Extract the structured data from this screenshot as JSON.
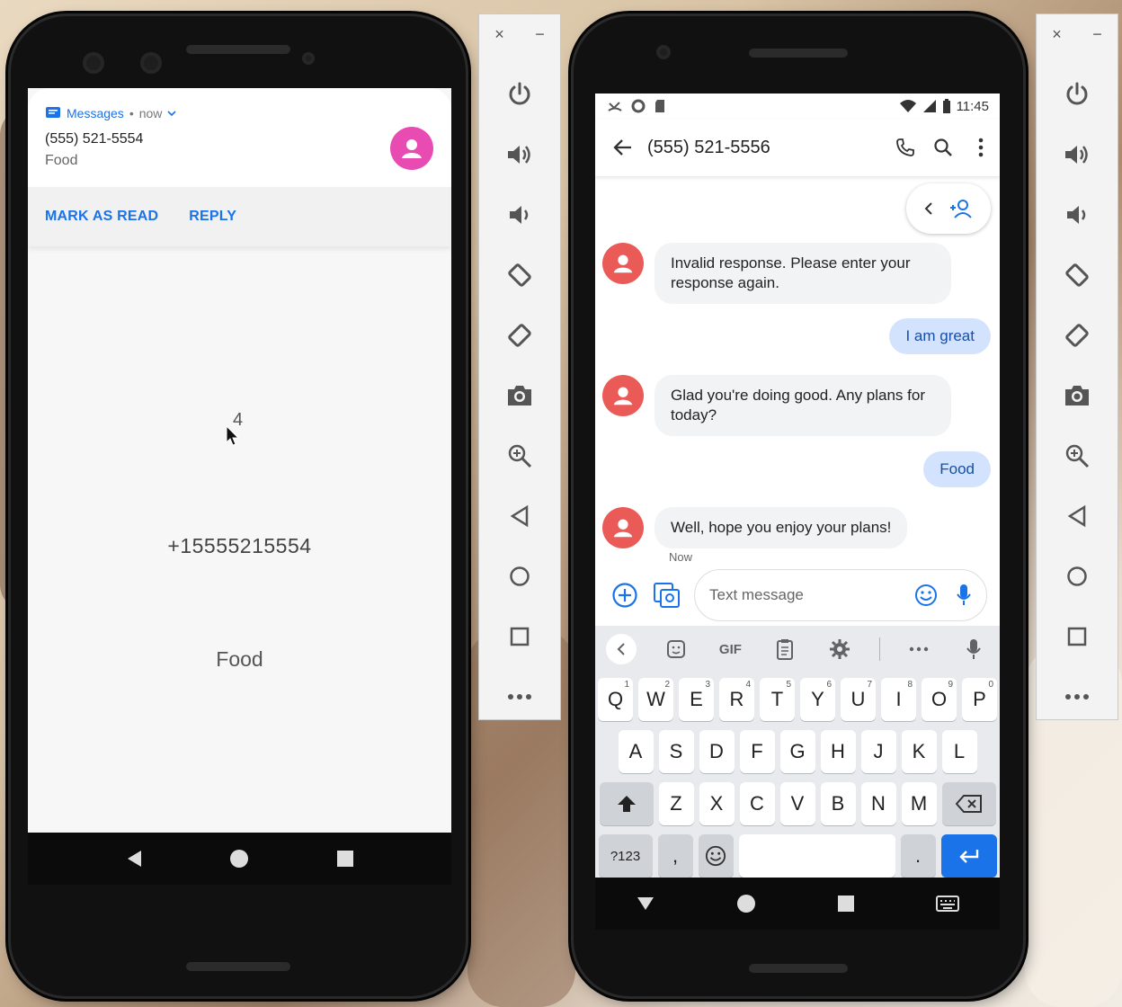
{
  "left_phone": {
    "notification": {
      "app_name": "Messages",
      "separator": "•",
      "time": "now",
      "sender": "(555) 521-5554",
      "body": "Food",
      "actions": [
        "MARK AS READ",
        "REPLY"
      ]
    },
    "counter": "4",
    "sender_number": "+15555215554",
    "message_text": "Food"
  },
  "right_phone": {
    "status": {
      "time": "11:45"
    },
    "header": {
      "title": "(555) 521-5556"
    },
    "messages": [
      {
        "direction": "in",
        "text": "Invalid response. Please enter your response again."
      },
      {
        "direction": "out",
        "text": "I am great"
      },
      {
        "direction": "in",
        "text": "Glad you're doing good. Any plans for today?"
      },
      {
        "direction": "out",
        "text": "Food"
      },
      {
        "direction": "in",
        "text": "Well, hope you enjoy your plans!"
      }
    ],
    "last_message_time": "Now",
    "compose": {
      "placeholder": "Text message"
    },
    "keyboard": {
      "gif_label": "GIF",
      "rows": [
        [
          [
            "Q",
            "1"
          ],
          [
            "W",
            "2"
          ],
          [
            "E",
            "3"
          ],
          [
            "R",
            "4"
          ],
          [
            "T",
            "5"
          ],
          [
            "Y",
            "6"
          ],
          [
            "U",
            "7"
          ],
          [
            "I",
            "8"
          ],
          [
            "O",
            "9"
          ],
          [
            "P",
            "0"
          ]
        ],
        [
          [
            "A",
            ""
          ],
          [
            "S",
            ""
          ],
          [
            "D",
            ""
          ],
          [
            "F",
            ""
          ],
          [
            "G",
            ""
          ],
          [
            "H",
            ""
          ],
          [
            "J",
            ""
          ],
          [
            "K",
            ""
          ],
          [
            "L",
            ""
          ]
        ],
        [
          [
            "Z",
            ""
          ],
          [
            "X",
            ""
          ],
          [
            "C",
            ""
          ],
          [
            "V",
            ""
          ],
          [
            "B",
            ""
          ],
          [
            "N",
            ""
          ],
          [
            "M",
            ""
          ]
        ]
      ],
      "symbols_key": "?123",
      "comma_key": ",",
      "period_key": "."
    }
  },
  "toolbar": {
    "close_label": "×",
    "minimize_label": "−",
    "buttons": [
      "power-icon",
      "volume-up-icon",
      "volume-down-icon",
      "rotate-left-icon",
      "rotate-right-icon",
      "camera-icon",
      "zoom-icon",
      "back-icon",
      "home-icon",
      "overview-icon",
      "more-icon"
    ]
  },
  "colors": {
    "accent": "#1a73e8",
    "avatar_pink": "#e84cb3",
    "avatar_red": "#ea5b58",
    "outgoing_bubble": "#d3e3fd"
  }
}
